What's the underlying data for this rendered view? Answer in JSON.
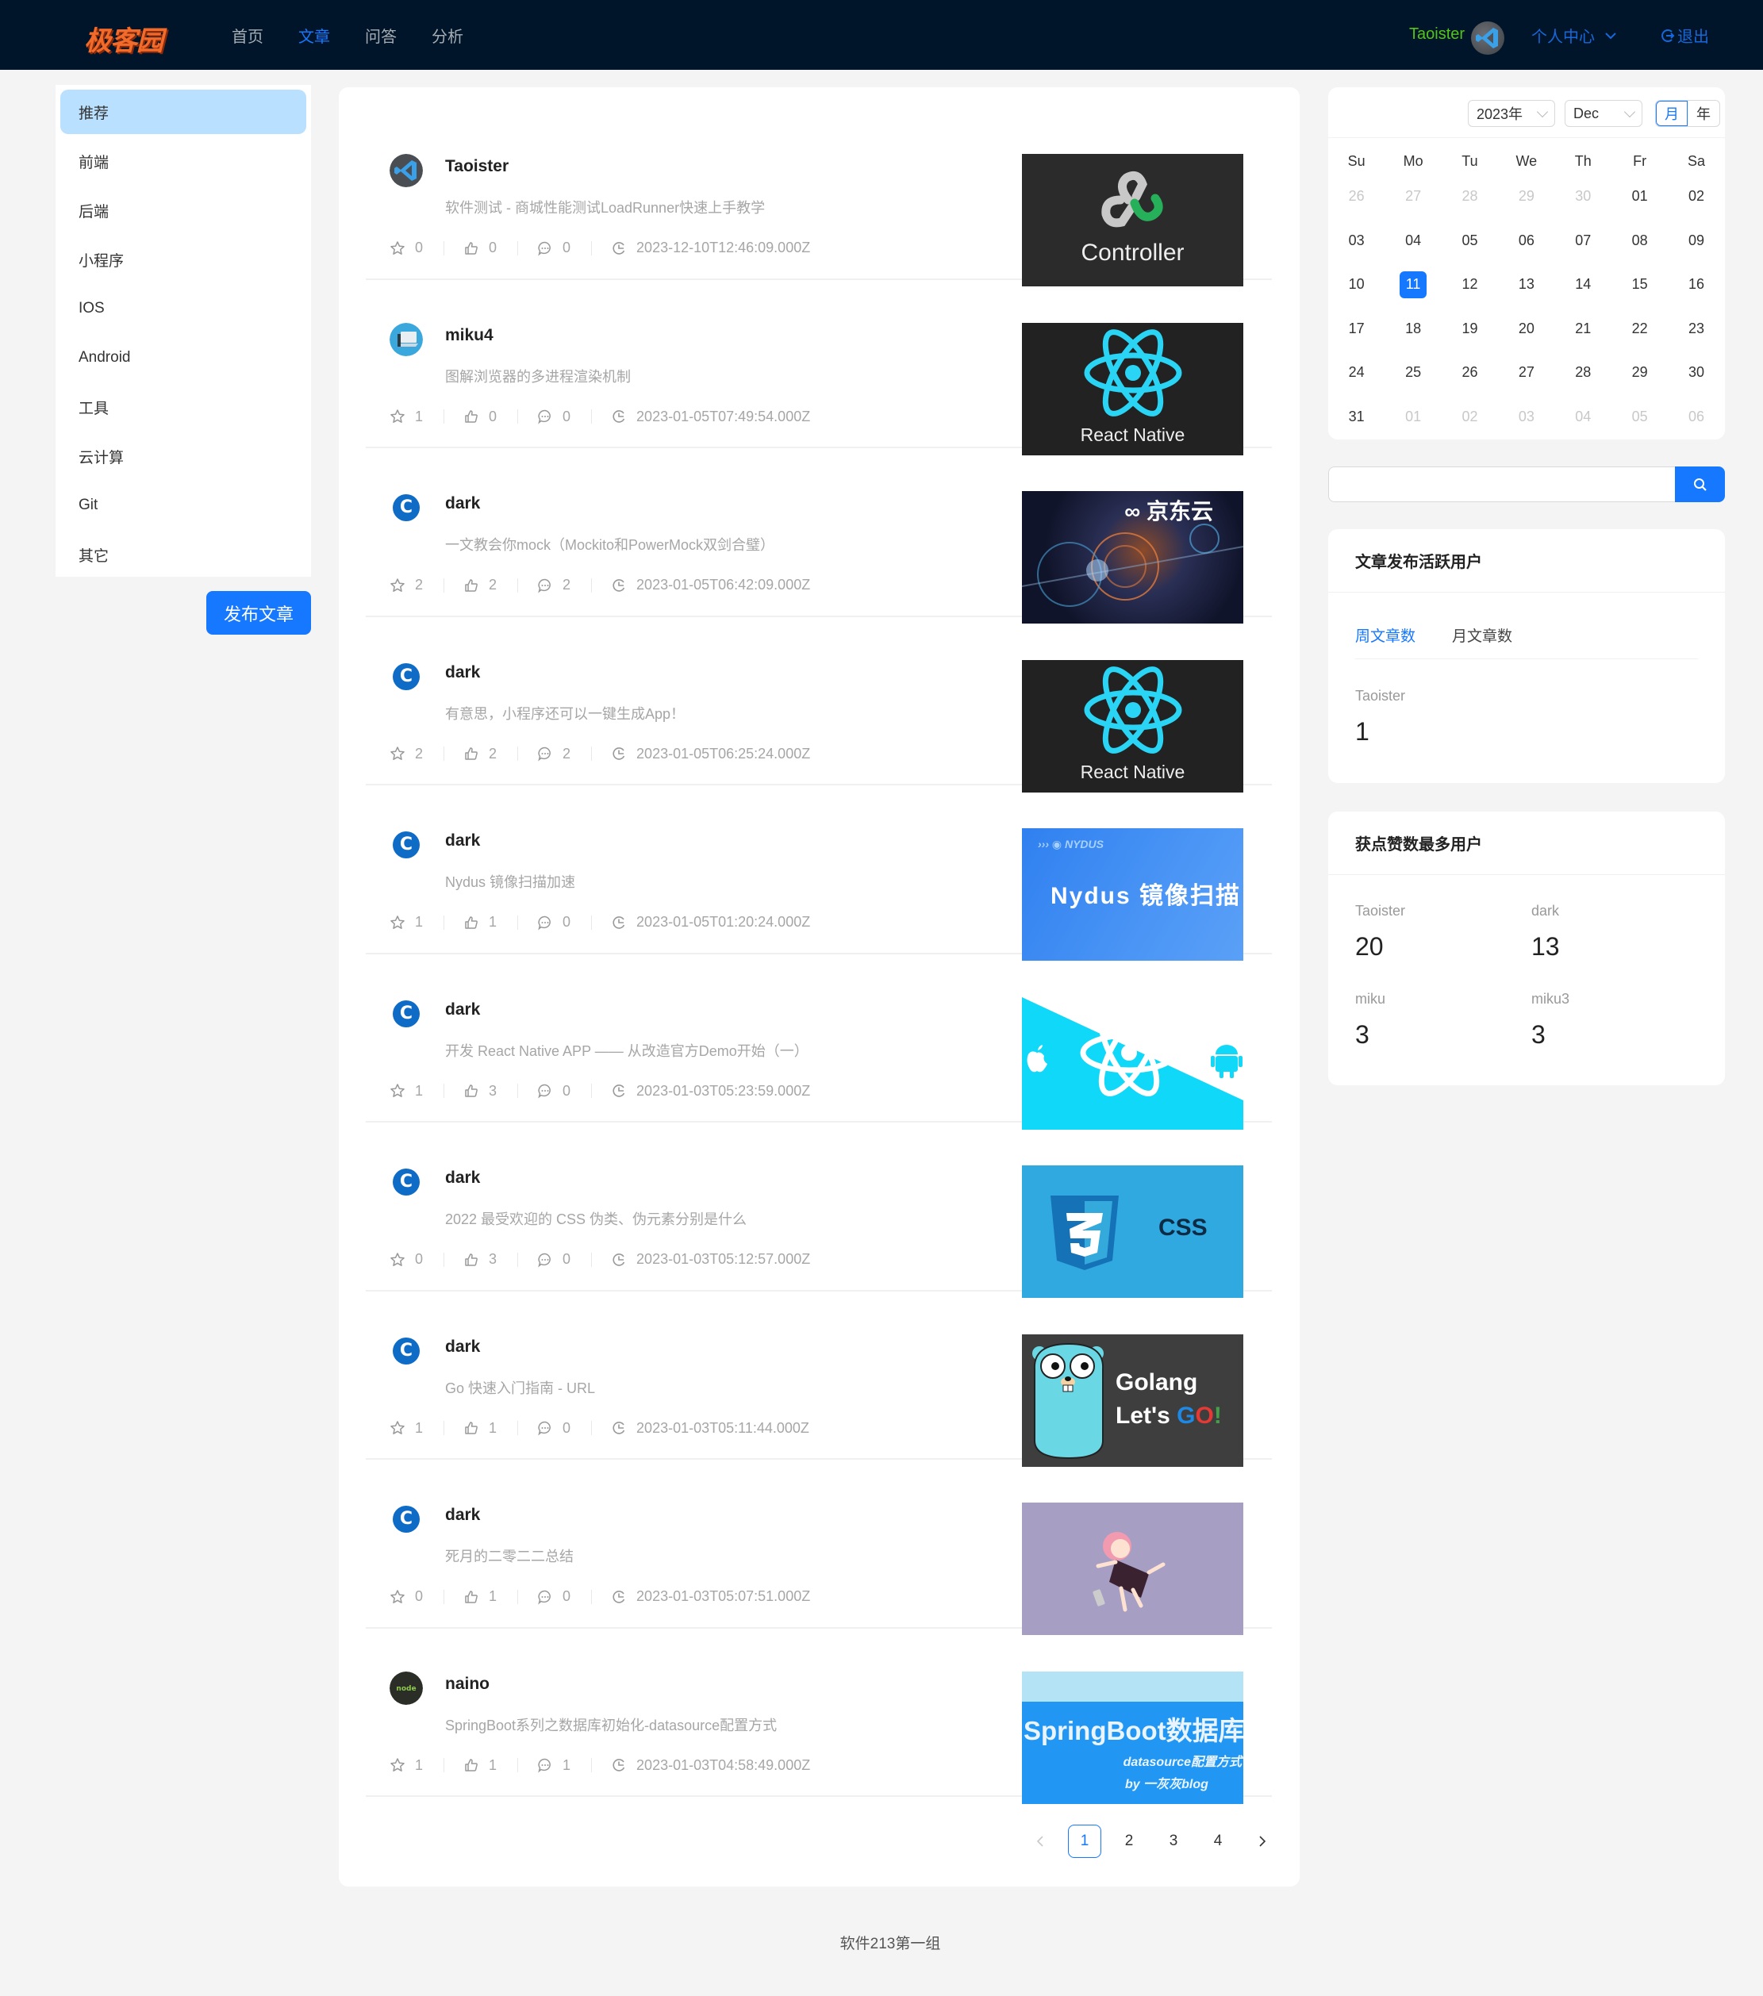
{
  "header": {
    "logo": "极客园",
    "nav": [
      {
        "label": "首页",
        "active": false
      },
      {
        "label": "文章",
        "active": true
      },
      {
        "label": "问答",
        "active": false
      },
      {
        "label": "分析",
        "active": false
      }
    ],
    "user_name": "Taoister",
    "user_center_label": "个人中心",
    "logout_label": "退出",
    "colors": {
      "bg": "#001529",
      "accent": "#1677ff",
      "user": "#52c41a",
      "logo": "#f26b2a"
    }
  },
  "sidebar": {
    "items": [
      {
        "label": "推荐",
        "active": true
      },
      {
        "label": "前端"
      },
      {
        "label": "后端"
      },
      {
        "label": "小程序"
      },
      {
        "label": "IOS"
      },
      {
        "label": "Android"
      },
      {
        "label": "工具"
      },
      {
        "label": "云计算"
      },
      {
        "label": "Git"
      },
      {
        "label": "其它"
      }
    ],
    "publish_button": "发布文章"
  },
  "articles": [
    {
      "author": "Taoister",
      "avatar": "vscode-avatar",
      "title": "软件测试 - 商城性能测试LoadRunner快速上手教学",
      "collects": "0",
      "likes": "0",
      "comments": "0",
      "time": "2023-12-10T12:46:09.000Z",
      "thumb": {
        "kind": "controller",
        "text": "Controller"
      }
    },
    {
      "author": "miku4",
      "avatar": "laptop-avatar",
      "title": "图解浏览器的多进程渲染机制",
      "collects": "1",
      "likes": "0",
      "comments": "0",
      "time": "2023-01-05T07:49:54.000Z",
      "thumb": {
        "kind": "react-dark",
        "text": "React Native"
      }
    },
    {
      "author": "dark",
      "avatar": "c-avatar",
      "title": "一文教会你mock（Mockito和PowerMock双剑合璧）",
      "collects": "2",
      "likes": "2",
      "comments": "2",
      "time": "2023-01-05T06:42:09.000Z",
      "thumb": {
        "kind": "jdcloud",
        "text": "京东云"
      }
    },
    {
      "author": "dark",
      "avatar": "c-avatar",
      "title": "有意思，小程序还可以一键生成App！",
      "collects": "2",
      "likes": "2",
      "comments": "2",
      "time": "2023-01-05T06:25:24.000Z",
      "thumb": {
        "kind": "react-dark",
        "text": "React Native"
      }
    },
    {
      "author": "dark",
      "avatar": "c-avatar",
      "title": "Nydus 镜像扫描加速",
      "collects": "1",
      "likes": "1",
      "comments": "0",
      "time": "2023-01-05T01:20:24.000Z",
      "thumb": {
        "kind": "nydus",
        "text": "Nydus 镜像扫描",
        "sub": "NYDUS"
      }
    },
    {
      "author": "dark",
      "avatar": "c-avatar",
      "title": "开发 React Native APP —— 从改造官方Demo开始（一）",
      "collects": "1",
      "likes": "3",
      "comments": "0",
      "time": "2023-01-03T05:23:59.000Z",
      "thumb": {
        "kind": "react-cyan",
        "text": ""
      }
    },
    {
      "author": "dark",
      "avatar": "c-avatar",
      "title": "2022 最受欢迎的 CSS 伪类、伪元素分别是什么",
      "collects": "0",
      "likes": "3",
      "comments": "0",
      "time": "2023-01-03T05:12:57.000Z",
      "thumb": {
        "kind": "css",
        "text": "CSS"
      }
    },
    {
      "author": "dark",
      "avatar": "c-avatar",
      "title": "Go 快速入门指南 - URL",
      "collects": "1",
      "likes": "1",
      "comments": "0",
      "time": "2023-01-03T05:11:44.000Z",
      "thumb": {
        "kind": "golang",
        "text": "Golang",
        "sub": "Let's GO!"
      }
    },
    {
      "author": "dark",
      "avatar": "c-avatar",
      "title": "死月的二零二二总结",
      "collects": "0",
      "likes": "1",
      "comments": "0",
      "time": "2023-01-03T05:07:51.000Z",
      "thumb": {
        "kind": "anime",
        "text": ""
      }
    },
    {
      "author": "naino",
      "avatar": "node-avatar",
      "title": "SpringBoot系列之数据库初始化-datasource配置方式",
      "collects": "1",
      "likes": "1",
      "comments": "1",
      "time": "2023-01-03T04:58:49.000Z",
      "thumb": {
        "kind": "springboot",
        "text": "SpringBoot数据库",
        "sub": "datasource配置方式",
        "sub2": "by 一灰灰blog"
      }
    }
  ],
  "pagination": {
    "pages": [
      "1",
      "2",
      "3",
      "4"
    ],
    "current": "1",
    "prev": "<",
    "next": ">"
  },
  "footer": "软件213第一组",
  "calendar": {
    "year": "2023年",
    "month": "Dec",
    "modes": [
      "月",
      "年"
    ],
    "active_mode": "月",
    "weekdays": [
      "Su",
      "Mo",
      "Tu",
      "We",
      "Th",
      "Fr",
      "Sa"
    ],
    "weeks": [
      [
        {
          "d": "26",
          "m": 1
        },
        {
          "d": "27",
          "m": 1
        },
        {
          "d": "28",
          "m": 1
        },
        {
          "d": "29",
          "m": 1
        },
        {
          "d": "30",
          "m": 1
        },
        {
          "d": "01"
        },
        {
          "d": "02"
        }
      ],
      [
        {
          "d": "03"
        },
        {
          "d": "04"
        },
        {
          "d": "05"
        },
        {
          "d": "06"
        },
        {
          "d": "07"
        },
        {
          "d": "08"
        },
        {
          "d": "09"
        }
      ],
      [
        {
          "d": "10"
        },
        {
          "d": "11",
          "s": 1
        },
        {
          "d": "12"
        },
        {
          "d": "13"
        },
        {
          "d": "14"
        },
        {
          "d": "15"
        },
        {
          "d": "16"
        }
      ],
      [
        {
          "d": "17"
        },
        {
          "d": "18"
        },
        {
          "d": "19"
        },
        {
          "d": "20"
        },
        {
          "d": "21"
        },
        {
          "d": "22"
        },
        {
          "d": "23"
        }
      ],
      [
        {
          "d": "24"
        },
        {
          "d": "25"
        },
        {
          "d": "26"
        },
        {
          "d": "27"
        },
        {
          "d": "28"
        },
        {
          "d": "29"
        },
        {
          "d": "30"
        }
      ],
      [
        {
          "d": "31"
        },
        {
          "d": "01",
          "m": 1
        },
        {
          "d": "02",
          "m": 1
        },
        {
          "d": "03",
          "m": 1
        },
        {
          "d": "04",
          "m": 1
        },
        {
          "d": "05",
          "m": 1
        },
        {
          "d": "06",
          "m": 1
        }
      ]
    ],
    "selected": "11"
  },
  "search": {
    "value": "",
    "placeholder": ""
  },
  "active_users": {
    "title": "文章发布活跃用户",
    "tabs": [
      {
        "label": "周文章数",
        "active": true
      },
      {
        "label": "月文章数"
      }
    ],
    "stats": [
      {
        "label": "Taoister",
        "value": "1"
      }
    ]
  },
  "top_liked": {
    "title": "获点赞数最多用户",
    "stats": [
      {
        "label": "Taoister",
        "value": "20"
      },
      {
        "label": "dark",
        "value": "13"
      },
      {
        "label": "miku",
        "value": "3"
      },
      {
        "label": "miku3",
        "value": "3"
      }
    ]
  }
}
